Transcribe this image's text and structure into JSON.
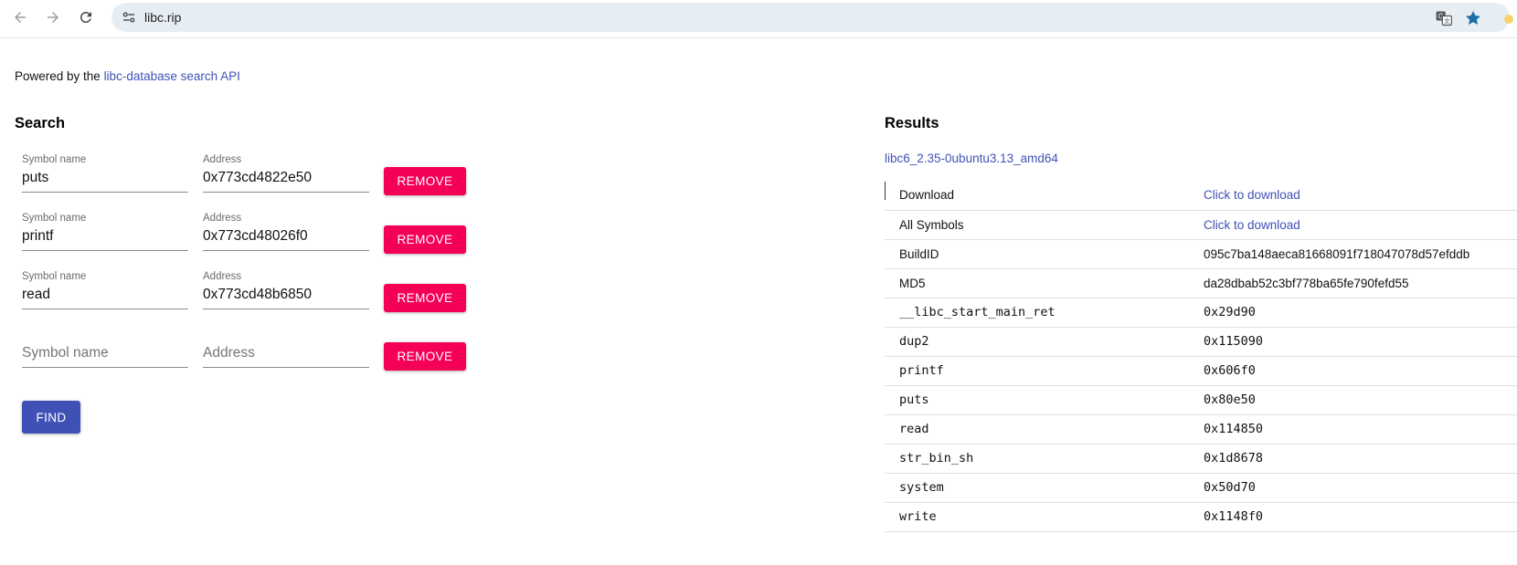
{
  "browser": {
    "url": "libc.rip"
  },
  "powered": {
    "prefix": "Powered by the ",
    "link_text": "libc-database search API"
  },
  "search": {
    "title": "Search",
    "symbol_label": "Symbol name",
    "address_label": "Address",
    "rows": [
      {
        "symbol": "puts",
        "address": "0x773cd4822e50",
        "remove_label": "REMOVE"
      },
      {
        "symbol": "printf",
        "address": "0x773cd48026f0",
        "remove_label": "REMOVE"
      },
      {
        "symbol": "read",
        "address": "0x773cd48b6850",
        "remove_label": "REMOVE"
      }
    ],
    "empty_row": {
      "symbol_placeholder": "Symbol name",
      "address_placeholder": "Address",
      "remove_label": "REMOVE"
    },
    "find_label": "FIND"
  },
  "results": {
    "title": "Results",
    "libc_name": "libc6_2.35-0ubuntu3.13_amd64",
    "rows": [
      {
        "key": "Download",
        "value": "Click to download",
        "kind": "link"
      },
      {
        "key": "All Symbols",
        "value": "Click to download",
        "kind": "link"
      },
      {
        "key": "BuildID",
        "value": "095c7ba148aeca81668091f718047078d57efddb",
        "kind": "text"
      },
      {
        "key": "MD5",
        "value": "da28dbab52c3bf778ba65fe790fefd55",
        "kind": "text"
      },
      {
        "key": "__libc_start_main_ret",
        "value": "0x29d90",
        "kind": "mono"
      },
      {
        "key": "dup2",
        "value": "0x115090",
        "kind": "mono"
      },
      {
        "key": "printf",
        "value": "0x606f0",
        "kind": "mono"
      },
      {
        "key": "puts",
        "value": "0x80e50",
        "kind": "mono"
      },
      {
        "key": "read",
        "value": "0x114850",
        "kind": "mono"
      },
      {
        "key": "str_bin_sh",
        "value": "0x1d8678",
        "kind": "mono"
      },
      {
        "key": "system",
        "value": "0x50d70",
        "kind": "mono"
      },
      {
        "key": "write",
        "value": "0x1148f0",
        "kind": "mono"
      }
    ]
  },
  "colors": {
    "remove": "#f50057",
    "primary": "#3f51b5",
    "omnibox": "#e6edf3"
  },
  "icons": [
    "back-arrow-icon",
    "forward-arrow-icon",
    "reload-icon",
    "site-settings-icon",
    "translate-icon",
    "bookmark-star-icon"
  ]
}
